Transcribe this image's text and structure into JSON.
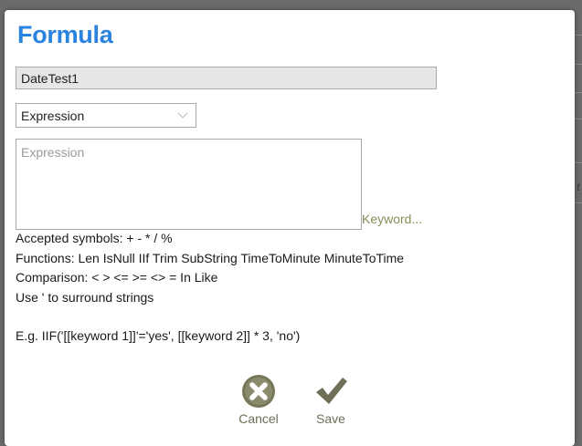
{
  "dialog": {
    "title": "Formula",
    "name_value": "DateTest1",
    "type_select": {
      "selected": "Expression"
    },
    "expression": {
      "value": "",
      "placeholder": "Expression"
    },
    "keyword_link": "Keyword...",
    "help": {
      "accepted": "Accepted symbols: + - * / %",
      "functions": "Functions: Len IsNull IIf Trim SubString TimeToMinute MinuteToTime",
      "comparison": "Comparison: < > <= >= <> = In Like",
      "strings": "Use ' to surround strings",
      "example": "E.g. IIF('[[keyword 1]]'='yes', [[keyword 2]] * 3, 'no')"
    },
    "buttons": {
      "cancel": "Cancel",
      "save": "Save"
    }
  },
  "background": {
    "partial_text": "t"
  },
  "colors": {
    "title": "#2b83e0",
    "icon": "#6f6f57",
    "overlay": "#6b6b6b"
  }
}
